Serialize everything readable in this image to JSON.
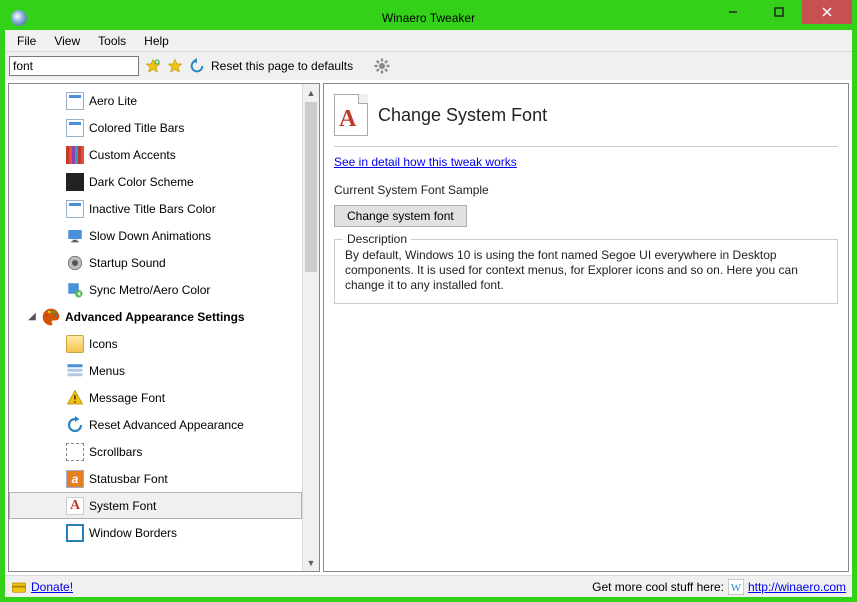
{
  "window": {
    "title": "Winaero Tweaker"
  },
  "menubar": {
    "items": [
      "File",
      "View",
      "Tools",
      "Help"
    ]
  },
  "toolbar": {
    "search_value": "font",
    "reset_label": "Reset this page to defaults"
  },
  "tree": {
    "top_group_items": [
      {
        "label": "Aero Lite",
        "icon": "window"
      },
      {
        "label": "Colored Title Bars",
        "icon": "window"
      },
      {
        "label": "Custom Accents",
        "icon": "stripes"
      },
      {
        "label": "Dark Color Scheme",
        "icon": "dark"
      },
      {
        "label": "Inactive Title Bars Color",
        "icon": "window"
      },
      {
        "label": "Slow Down Animations",
        "icon": "monitor"
      },
      {
        "label": "Startup Sound",
        "icon": "speaker"
      },
      {
        "label": "Sync Metro/Aero Color",
        "icon": "sync"
      }
    ],
    "heading": "Advanced Appearance Settings",
    "sub_items": [
      {
        "label": "Icons",
        "icon": "folder"
      },
      {
        "label": "Menus",
        "icon": "menus"
      },
      {
        "label": "Message Font",
        "icon": "warning"
      },
      {
        "label": "Reset Advanced Appearance",
        "icon": "refresh"
      },
      {
        "label": "Scrollbars",
        "icon": "scrollbar"
      },
      {
        "label": "Statusbar Font",
        "icon": "orange-a"
      },
      {
        "label": "System Font",
        "icon": "letter-a",
        "selected": true
      },
      {
        "label": "Window Borders",
        "icon": "open"
      }
    ]
  },
  "right": {
    "title": "Change System Font",
    "link_text": "See in detail how this tweak works",
    "sample_label": "Current System Font Sample",
    "button_label": "Change system font",
    "desc_legend": "Description",
    "desc_text": "By default, Windows 10 is using the font named Segoe UI everywhere in Desktop components. It is used for context menus, for Explorer icons and so on. Here you can change it to any installed font."
  },
  "statusbar": {
    "donate": "Donate!",
    "promo": "Get more cool stuff here:",
    "url": "http://winaero.com"
  }
}
